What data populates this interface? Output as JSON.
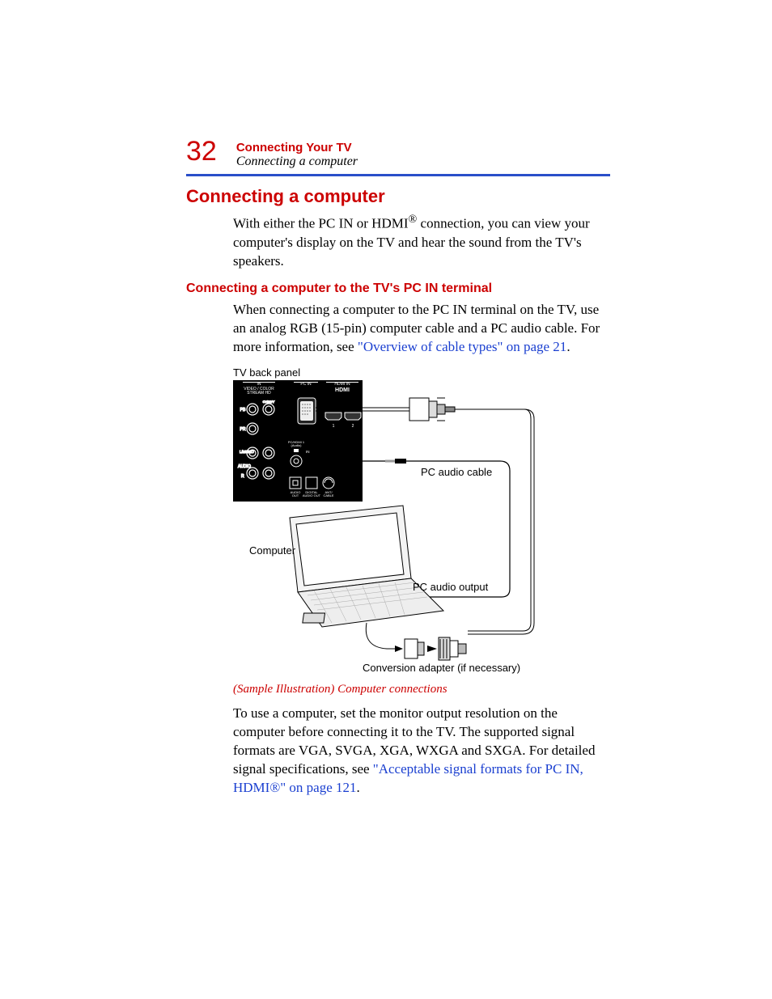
{
  "page_number": "32",
  "header": {
    "chapter": "Connecting Your TV",
    "section_path": "Connecting a computer"
  },
  "h1": "Connecting a computer",
  "intro_before_sup": "With either the PC IN or HDMI",
  "intro_sup": "®",
  "intro_after_sup": " connection, you can view your computer's display on the TV and hear the sound from the TV's speakers.",
  "h2": "Connecting a computer to the TV's PC IN terminal",
  "para2_plain": "When connecting a computer to the PC IN terminal on the TV, use an analog RGB (15-pin) computer cable and a PC audio cable. For more information, see ",
  "para2_link": "\"Overview of cable types\" on page 21",
  "para2_after": ".",
  "illustration": {
    "tv_back_panel": "TV back panel",
    "panel_labels": {
      "in": "IN",
      "video_color_stream_hd": "VIDEO / COLOR\nSTREAM HD",
      "pc_in": "PC IN",
      "hdmi_in": "HDMI IN",
      "hdmi_logo": "HDMI",
      "pb": "PB",
      "cvbs_y": "CVBS/Y",
      "pr": "PR",
      "lmono": "L/MONO",
      "audio": "AUDIO",
      "r": "R",
      "pc_hdmi1_audio": "PC/HDMI 1\n(Audio)",
      "pc_hdmi1_in": "IN",
      "audio_out": "AUDIO\nOUT",
      "digital_audio_out": "DIGITAL\nAUDIO OUT",
      "ant_cable": "ANT/\nCABLE",
      "port1": "1",
      "port2": "2"
    },
    "callouts": {
      "computer": "Computer",
      "pc_audio_cable": "PC audio cable",
      "pc_audio_output": "PC audio output",
      "conversion_adapter": "Conversion adapter (if necessary)"
    }
  },
  "caption": "(Sample Illustration) Computer connections",
  "para3_plain": "To use a computer, set the monitor output resolution on the computer before connecting it to the TV. The supported signal formats are VGA, SVGA, XGA, WXGA and SXGA. For detailed signal specifications, see ",
  "para3_link": "\"Acceptable signal formats for PC IN, HDMI®\" on page 121",
  "para3_after": "."
}
